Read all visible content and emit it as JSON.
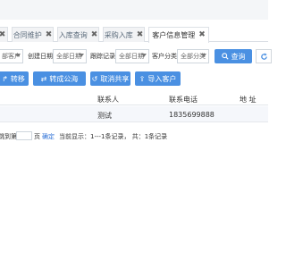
{
  "tabs": [
    {
      "label": "合同维护",
      "active": false
    },
    {
      "label": "入库查询",
      "active": false
    },
    {
      "label": "采购入库",
      "active": false
    },
    {
      "label": "客户信息管理",
      "active": true
    }
  ],
  "tab_close_glyph": "✖",
  "filters": {
    "customer_select": "部客户",
    "create_date_label": "创建日期:",
    "create_date_value": "全部日期",
    "follow_date_label": "跟踪记录:",
    "follow_date_value": "全部日期",
    "category_label": "客户分类:",
    "category_value": "全部分类",
    "search_label": "查询",
    "search_icon": "magnifier",
    "refresh_icon": "refresh"
  },
  "actions": [
    {
      "label": "转移",
      "icon": "share-arrow"
    },
    {
      "label": "转成公海",
      "icon": "swap-arrows"
    },
    {
      "label": "取消共享",
      "icon": "undo-circle"
    },
    {
      "label": "导入客户",
      "icon": "upload"
    }
  ],
  "table": {
    "columns": [
      "联系人",
      "联系电话",
      "地 址"
    ],
    "rows": [
      {
        "contact": "测试",
        "phone": "1835699888",
        "address": ""
      }
    ]
  },
  "pager": {
    "goto_prefix": "跳到第",
    "goto_suffix": "页",
    "confirm": "确定",
    "summary": "当前显示：1---1条记录， 共：1条记录"
  },
  "colors": {
    "accent": "#4a90e2",
    "tab_bg": "#f2f3f5",
    "row_bg": "#f5f7fb"
  }
}
